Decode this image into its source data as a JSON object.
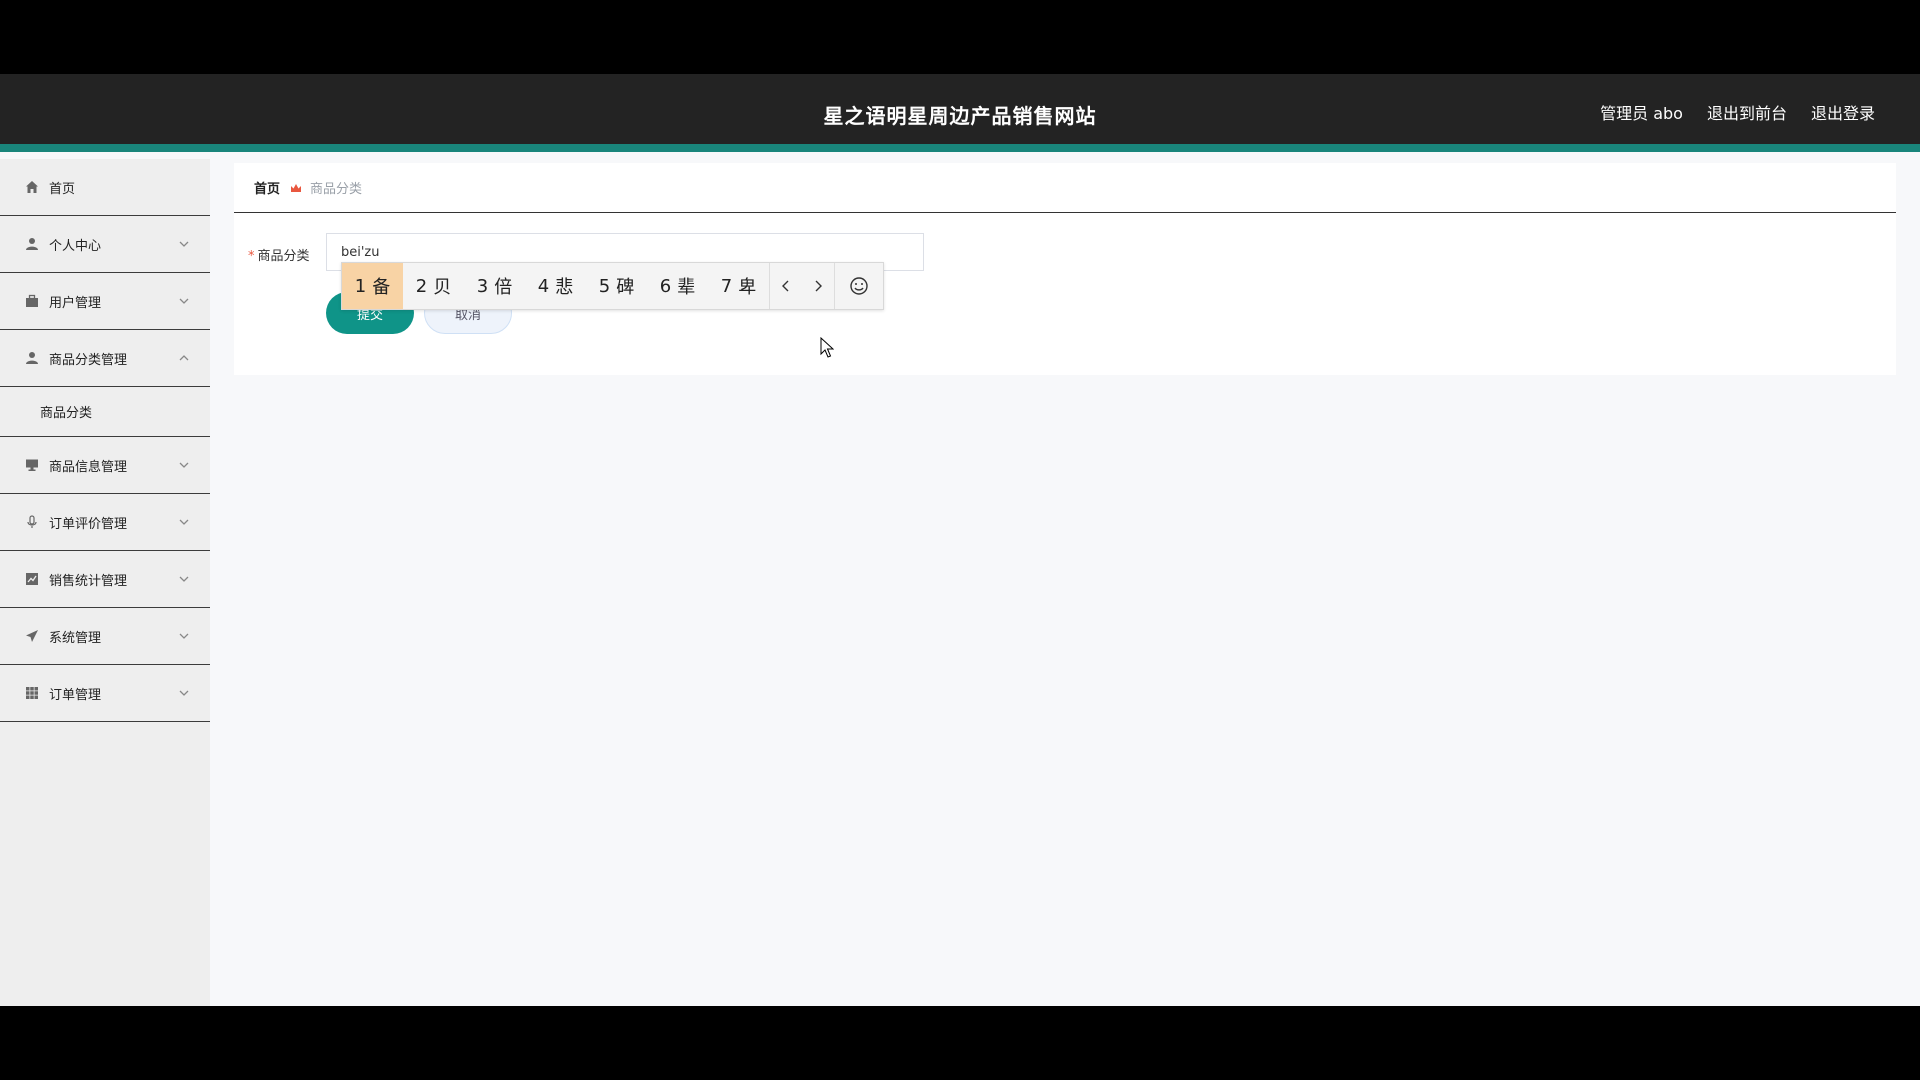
{
  "header": {
    "title": "星之语明星周边产品销售网站",
    "links": [
      "管理员 abo",
      "退出到前台",
      "退出登录"
    ]
  },
  "sidebar": {
    "items": [
      {
        "label": "首页",
        "icon": "home-icon",
        "expandable": false
      },
      {
        "label": "个人中心",
        "icon": "user-icon",
        "expandable": true
      },
      {
        "label": "用户管理",
        "icon": "briefcase-icon",
        "expandable": true
      },
      {
        "label": "商品分类管理",
        "icon": "user-icon",
        "expandable": true,
        "expanded": true
      },
      {
        "label": "商品信息管理",
        "icon": "monitor-icon",
        "expandable": true
      },
      {
        "label": "订单评价管理",
        "icon": "microphone-icon",
        "expandable": true
      },
      {
        "label": "销售统计管理",
        "icon": "chart-icon",
        "expandable": true
      },
      {
        "label": "系统管理",
        "icon": "paper-plane-icon",
        "expandable": true
      },
      {
        "label": "订单管理",
        "icon": "grid-icon",
        "expandable": true
      }
    ],
    "submenu": {
      "label": "商品分类",
      "parent": "商品分类管理"
    }
  },
  "breadcrumb": {
    "home": "首页",
    "current": "商品分类"
  },
  "form": {
    "field_label": "商品分类",
    "required_mark": "*",
    "field_value": "bei'zu",
    "submit_label": "提交",
    "cancel_label": "取消"
  },
  "ime": {
    "candidates": [
      {
        "num": "1",
        "char": "备"
      },
      {
        "num": "2",
        "char": "贝"
      },
      {
        "num": "3",
        "char": "倍"
      },
      {
        "num": "4",
        "char": "悲"
      },
      {
        "num": "5",
        "char": "碑"
      },
      {
        "num": "6",
        "char": "辈"
      },
      {
        "num": "7",
        "char": "卑"
      }
    ]
  },
  "colors": {
    "header_bg": "#232323",
    "accent": "#19857b",
    "submit_bg": "#0f9488",
    "breadcrumb_icon": "#e9573f"
  }
}
